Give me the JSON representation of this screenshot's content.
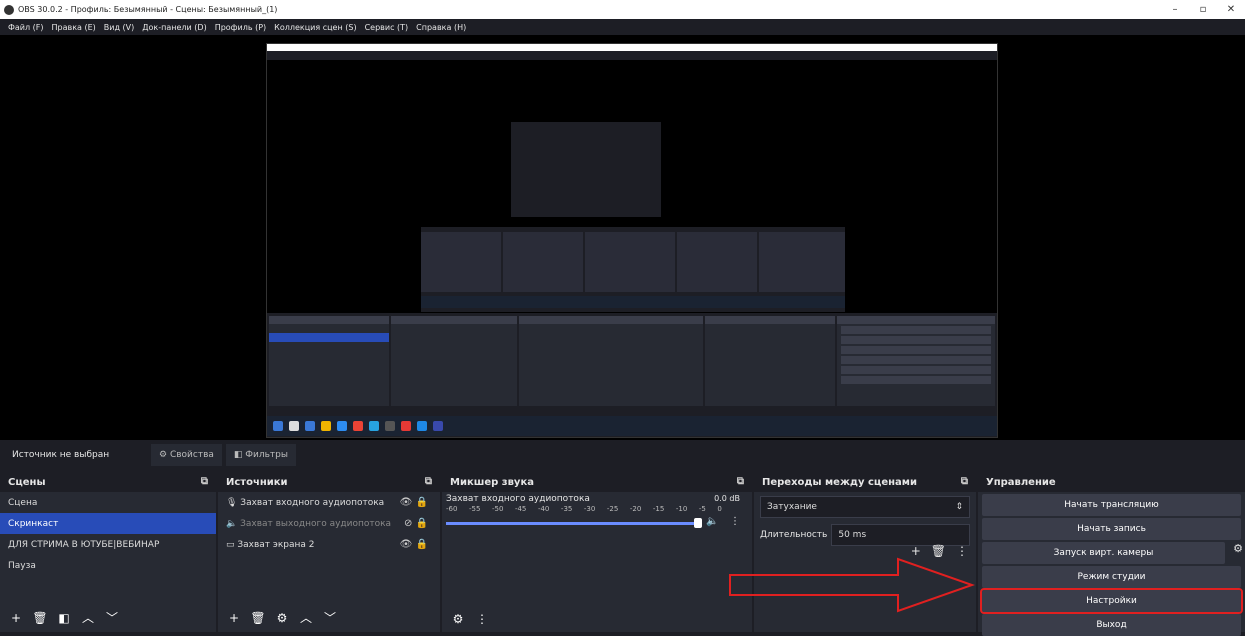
{
  "titlebar": {
    "title": "OBS 30.0.2 - Профиль: Безымянный - Сцены: Безымянный_(1)"
  },
  "menu": [
    "Файл (F)",
    "Правка (E)",
    "Вид (V)",
    "Док-панели (D)",
    "Профиль (P)",
    "Коллекция сцен (S)",
    "Сервис (T)",
    "Справка (H)"
  ],
  "source_bar": {
    "no_source": "Источник не выбран",
    "properties": "Свойства",
    "filters": "Фильтры"
  },
  "scenes": {
    "title": "Сцены",
    "items": [
      "Сцена",
      "Скринкаст",
      "ДЛЯ СТРИМА В ЮТУБЕ|ВЕБИНАР",
      "Пауза"
    ],
    "selected": 1
  },
  "sources": {
    "title": "Источники",
    "items": [
      "Захват входного аудиопотока",
      "Захват выходного аудиопотока",
      "Захват экрана 2"
    ]
  },
  "mixer": {
    "title": "Микшер звука",
    "channel": "Захват входного аудиопотока",
    "db": "0.0 dB",
    "ticks": [
      "-60",
      "-55",
      "-50",
      "-45",
      "-40",
      "-35",
      "-30",
      "-25",
      "-20",
      "-15",
      "-10",
      "-5",
      "0"
    ]
  },
  "transitions": {
    "title": "Переходы между сценами",
    "type": "Затухание",
    "duration_label": "Длительность",
    "duration_value": "50 ms"
  },
  "controls": {
    "title": "Управление",
    "buttons": [
      "Начать трансляцию",
      "Начать запись",
      "Запуск вирт. камеры",
      "Режим студии",
      "Настройки",
      "Выход"
    ],
    "highlighted": 4
  },
  "accent": "#284cb8",
  "highlight_color": "#e02020"
}
